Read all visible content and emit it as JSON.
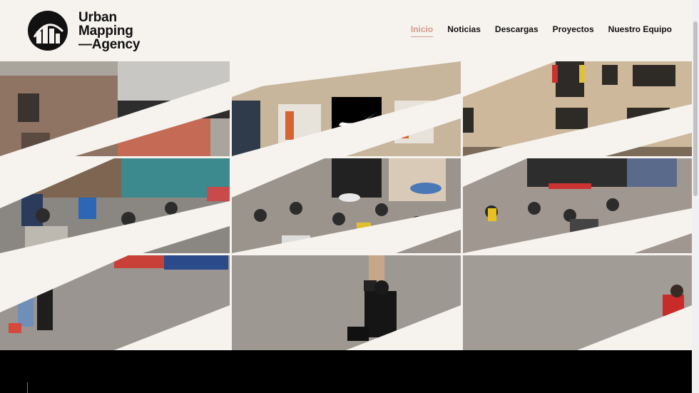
{
  "brand": {
    "line1": "Urban",
    "line2": "Mapping",
    "line3": "—Agency",
    "logo_icon": "city-skyline-in-circle"
  },
  "nav": {
    "items": [
      {
        "label": "Inicio",
        "active": true
      },
      {
        "label": "Noticias",
        "active": false
      },
      {
        "label": "Descargas",
        "active": false
      },
      {
        "label": "Proyectos",
        "active": false
      },
      {
        "label": "Nuestro Equipo",
        "active": false
      }
    ]
  },
  "colors": {
    "background": "#f6f3ef",
    "nav_active": "#d49a8c",
    "footer": "#000000"
  },
  "gallery": {
    "rows": 3,
    "columns": 3,
    "tiles": [
      {
        "row": 0,
        "col": 0,
        "scene": "brick-building-with-mural"
      },
      {
        "row": 0,
        "col": 1,
        "scene": "building-with-nike-sign"
      },
      {
        "row": 0,
        "col": 2,
        "scene": "building-facade-with-flags"
      },
      {
        "row": 1,
        "col": 0,
        "scene": "street-market-stalls"
      },
      {
        "row": 1,
        "col": 1,
        "scene": "crowded-plaza-with-umbrellas"
      },
      {
        "row": 1,
        "col": 2,
        "scene": "plaza-vendors-and-crowd"
      },
      {
        "row": 2,
        "col": 0,
        "scene": "pedestrians-and-red-dog"
      },
      {
        "row": 2,
        "col": 1,
        "scene": "people-walking-on-plaza"
      },
      {
        "row": 2,
        "col": 2,
        "scene": "empty-plaza-pavement"
      }
    ]
  }
}
